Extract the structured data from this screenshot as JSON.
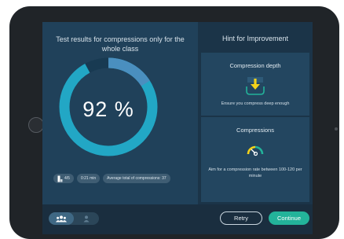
{
  "left": {
    "title": "Test results for compressions only for the whole class",
    "score_percent": 92,
    "score_label": "92 %",
    "stats": {
      "count": "4/5",
      "duration": "0:21 min",
      "total_compressions": "Average total of compressions: 37"
    }
  },
  "right": {
    "title": "Hint for Improvement",
    "cards": [
      {
        "title": "Compression depth",
        "text": "Ensure you compress deep enough",
        "icon": "compression-depth-icon"
      },
      {
        "title": "Compressions",
        "text": "Aim for a compression rate between 100-120 per minute",
        "icon": "compression-rate-gauge-icon"
      }
    ]
  },
  "bottom": {
    "view_toggle": [
      {
        "icon": "group-icon",
        "selected": true
      },
      {
        "icon": "person-icon",
        "selected": false
      }
    ],
    "retry_label": "Retry",
    "continue_label": "Continue"
  },
  "colors": {
    "gauge_primary": "#22a7c5",
    "gauge_secondary": "#4a8fbf",
    "gauge_track": "#183a52",
    "accent_green": "#23b39a",
    "hint_yellow": "#f4d21b"
  }
}
